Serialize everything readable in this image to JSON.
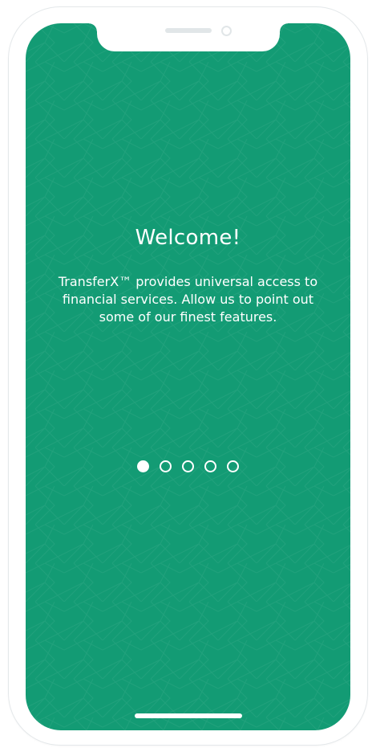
{
  "onboarding": {
    "title": "Welcome!",
    "description": "TransferX™ provides universal access to financial services. Allow us to point out some of our finest features.",
    "page_indicator": {
      "total_pages": 5,
      "current_page": 1
    }
  },
  "theme": {
    "background_color": "#139b74",
    "text_color": "#ffffff",
    "device_frame_color": "#ffffff"
  }
}
